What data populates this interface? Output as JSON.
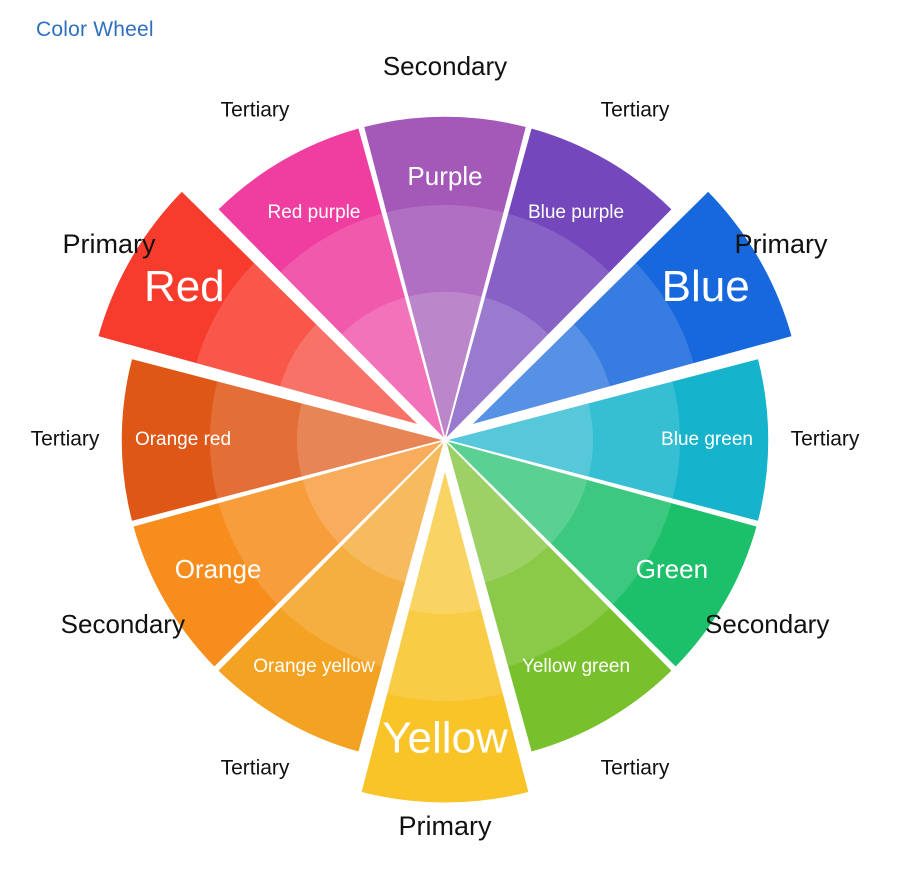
{
  "header": {
    "title": "Color Wheel"
  },
  "wheel": {
    "segments": [
      {
        "name": "Purple",
        "category": "Secondary",
        "color": "#a458b8",
        "level": "secondary"
      },
      {
        "name": "Blue purple",
        "category": "Tertiary",
        "color": "#7448bc",
        "level": "tertiary"
      },
      {
        "name": "Blue",
        "category": "Primary",
        "color": "#1768dc",
        "level": "primary"
      },
      {
        "name": "Blue green",
        "category": "Tertiary",
        "color": "#15b4cc",
        "level": "tertiary"
      },
      {
        "name": "Green",
        "category": "Secondary",
        "color": "#1cbf6a",
        "level": "secondary"
      },
      {
        "name": "Yellow green",
        "category": "Tertiary",
        "color": "#79c12c",
        "level": "tertiary"
      },
      {
        "name": "Yellow",
        "category": "Primary",
        "color": "#f8c428",
        "level": "primary"
      },
      {
        "name": "Orange yellow",
        "category": "Tertiary",
        "color": "#f4a221",
        "level": "tertiary"
      },
      {
        "name": "Orange",
        "category": "Secondary",
        "color": "#f78d1c",
        "level": "secondary"
      },
      {
        "name": "Orange red",
        "category": "Tertiary",
        "color": "#df5716",
        "level": "tertiary"
      },
      {
        "name": "Red",
        "category": "Primary",
        "color": "#f73c2d",
        "level": "primary"
      },
      {
        "name": "Red purple",
        "category": "Tertiary",
        "color": "#ef3ea0",
        "level": "tertiary"
      }
    ]
  }
}
